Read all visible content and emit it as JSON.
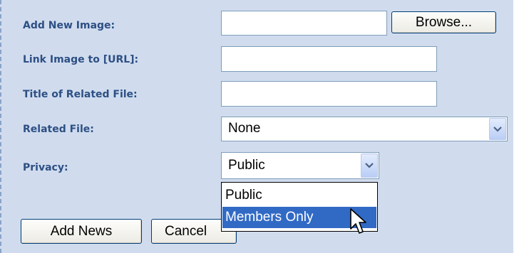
{
  "form": {
    "add_image_label": "Add New Image:",
    "link_label": "Link Image to [URL]:",
    "title_label": "Title of Related File:",
    "related_label": "Related File:",
    "privacy_label": "Privacy:",
    "browse_label": "Browse...",
    "image_value": "",
    "link_value": "",
    "title_value": "",
    "related_selected": "None",
    "privacy_selected": "Public",
    "privacy_options": [
      "Public",
      "Members Only"
    ],
    "privacy_highlighted": "Members Only"
  },
  "buttons": {
    "add_news": "Add News",
    "cancel": "Cancel"
  },
  "colors": {
    "panel_bg": "#d0dcee",
    "label_color": "#2d4f84",
    "selection_highlight": "#316ac5"
  },
  "icons": [
    "chevron-down-icon",
    "mouse-cursor-icon"
  ]
}
